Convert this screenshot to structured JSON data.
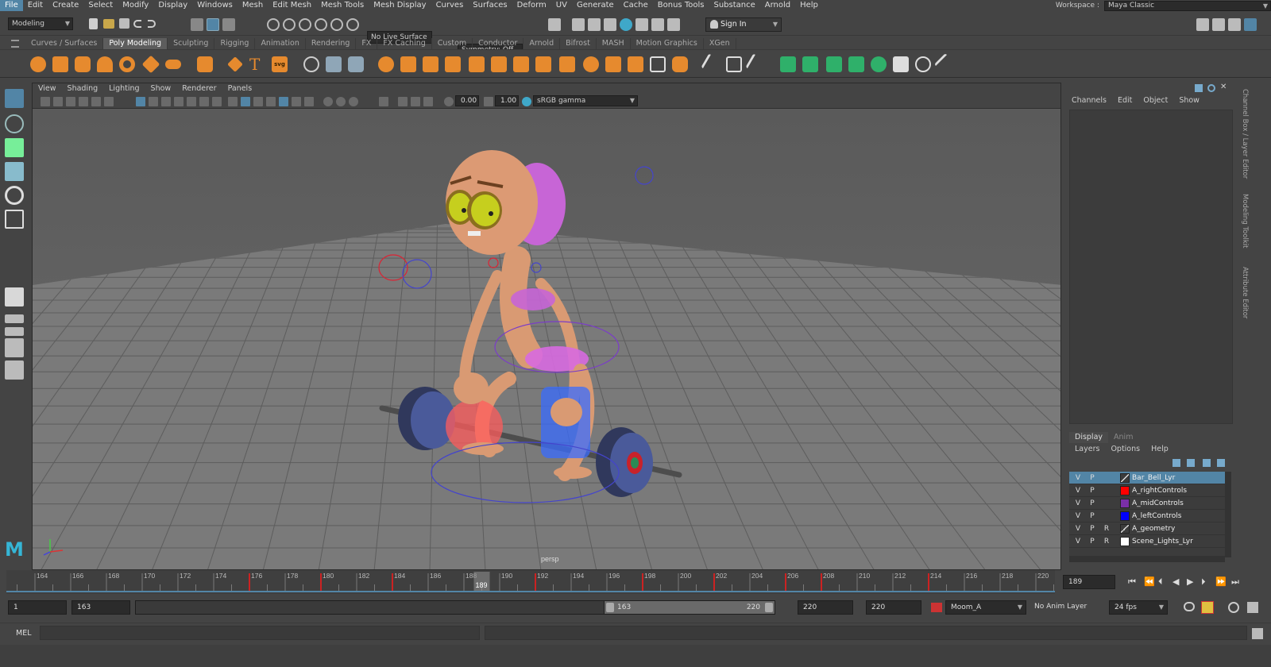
{
  "menubar": {
    "items": [
      "File",
      "Edit",
      "Create",
      "Select",
      "Modify",
      "Display",
      "Windows",
      "Mesh",
      "Edit Mesh",
      "Mesh Tools",
      "Mesh Display",
      "Curves",
      "Surfaces",
      "Deform",
      "UV",
      "Generate",
      "Cache",
      "Bonus Tools",
      "Substance",
      "Arnold",
      "Help"
    ],
    "workspace_label": "Workspace :",
    "workspace_value": "Maya Classic"
  },
  "statusline": {
    "menuset": "Modeling",
    "live_surface": "No Live Surface",
    "symmetry": "Symmetry: Off",
    "sign_in": "Sign In"
  },
  "shelf": {
    "tabs": [
      "Curves / Surfaces",
      "Poly Modeling",
      "Sculpting",
      "Rigging",
      "Animation",
      "Rendering",
      "FX",
      "FX Caching",
      "Custom",
      "Conductor",
      "Arnold",
      "Bifrost",
      "MASH",
      "Motion Graphics",
      "XGen"
    ],
    "active_tab": "Poly Modeling"
  },
  "viewport": {
    "menus": [
      "View",
      "Shading",
      "Lighting",
      "Show",
      "Renderer",
      "Panels"
    ],
    "exposure": "0.00",
    "gamma": "1.00",
    "colorspace": "sRGB gamma",
    "camera_label": "persp"
  },
  "channelbox": {
    "menus": [
      "Channels",
      "Edit",
      "Object",
      "Show"
    ]
  },
  "layereditor": {
    "tabs": [
      "Display",
      "Anim"
    ],
    "menus": [
      "Layers",
      "Options",
      "Help"
    ],
    "layers": [
      {
        "v": "V",
        "p": "P",
        "r": "",
        "color": "",
        "name": "Bar_Bell_Lyr",
        "selected": true
      },
      {
        "v": "V",
        "p": "P",
        "r": "",
        "color": "#ff0000",
        "name": "A_rightControls",
        "selected": false
      },
      {
        "v": "V",
        "p": "P",
        "r": "",
        "color": "#7a2fa8",
        "name": "A_midControls",
        "selected": false
      },
      {
        "v": "V",
        "p": "P",
        "r": "",
        "color": "#0000ff",
        "name": "A_leftControls",
        "selected": false
      },
      {
        "v": "V",
        "p": "P",
        "r": "R",
        "color": "",
        "name": "A_geometry",
        "selected": false
      },
      {
        "v": "V",
        "p": "P",
        "r": "R",
        "color": "#ffffff",
        "name": "Scene_Lights_Lyr",
        "selected": false
      }
    ]
  },
  "sidetabs": [
    "Channel Box / Layer Editor",
    "Modeling Toolkit",
    "Attribute Editor"
  ],
  "timeline": {
    "ticks": [
      "164",
      "166",
      "168",
      "170",
      "172",
      "174",
      "176",
      "178",
      "180",
      "182",
      "184",
      "186",
      "188",
      "190",
      "192",
      "194",
      "196",
      "198",
      "200",
      "202",
      "204",
      "206",
      "208",
      "210",
      "212",
      "214",
      "216",
      "218",
      "220"
    ],
    "current_frame": "189",
    "keys": [
      176,
      180,
      184,
      192,
      198,
      202,
      206,
      208,
      214
    ]
  },
  "playback": {
    "current_frame": "189"
  },
  "range": {
    "anim_start": "1",
    "start": "163",
    "slider_start": "163",
    "slider_end": "220",
    "end": "220",
    "anim_end": "220",
    "character": "Moom_A",
    "anim_layer": "No Anim Layer",
    "fps": "24 fps"
  },
  "cmdline": {
    "lang": "MEL"
  }
}
